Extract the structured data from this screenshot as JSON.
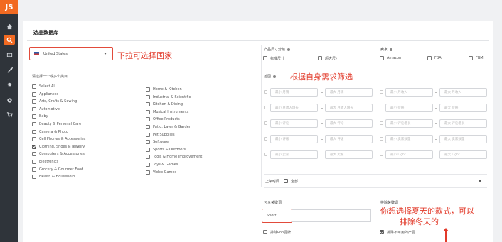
{
  "sidebar": {
    "logo": "JS",
    "icons": [
      "home-icon",
      "search-icon",
      "gallery-icon",
      "tools-icon",
      "graduation-icon",
      "settings-icon",
      "cart-icon"
    ]
  },
  "page": {
    "title": "选品数据库"
  },
  "country": {
    "selected": "United States"
  },
  "annotations": {
    "country_hint": "下拉可选择国家",
    "filter_hint": "根据自身需求筛选",
    "summer_hint_line1": "你想选择夏天的款式，可以",
    "summer_hint_line2": "排除冬天的"
  },
  "categories": {
    "label": "请选择一个或多个类目",
    "col1": [
      {
        "label": "Select All",
        "checked": false
      },
      {
        "label": "Appliances",
        "checked": false
      },
      {
        "label": "Arts, Crafts & Sewing",
        "checked": false
      },
      {
        "label": "Automotive",
        "checked": false
      },
      {
        "label": "Baby",
        "checked": false
      },
      {
        "label": "Beauty & Personal Care",
        "checked": false
      },
      {
        "label": "Camera & Photo",
        "checked": false
      },
      {
        "label": "Cell Phones & Accessories",
        "checked": false
      },
      {
        "label": "Clothing, Shoes & Jewelry",
        "checked": true
      },
      {
        "label": "Computers & Accessories",
        "checked": false
      },
      {
        "label": "Electronics",
        "checked": false
      },
      {
        "label": "Grocery & Gourmet Food",
        "checked": false
      },
      {
        "label": "Health & Household",
        "checked": false
      }
    ],
    "col2": [
      {
        "label": "Home & Kitchen",
        "checked": false
      },
      {
        "label": "Industrial & Scientific",
        "checked": false
      },
      {
        "label": "Kitchen & Dining",
        "checked": false
      },
      {
        "label": "Musical Instruments",
        "checked": false
      },
      {
        "label": "Office Products",
        "checked": false
      },
      {
        "label": "Patio, Lawn & Garden",
        "checked": false
      },
      {
        "label": "Pet Supplies",
        "checked": false
      },
      {
        "label": "Software",
        "checked": false
      },
      {
        "label": "Sports & Outdoors",
        "checked": false
      },
      {
        "label": "Tools & Home Improvement",
        "checked": false
      },
      {
        "label": "Toys & Games",
        "checked": false
      },
      {
        "label": "Video Games",
        "checked": false
      }
    ]
  },
  "size_tier": {
    "label": "产品尺寸分级",
    "options": [
      "标准尺寸",
      "超大尺寸"
    ]
  },
  "sellers": {
    "label": "卖家",
    "options": [
      "Amazon",
      "FBA",
      "FBM"
    ]
  },
  "range": {
    "label": "范围",
    "rows": [
      [
        "最小 月销",
        "最大 月销",
        "最小 月收入",
        "最大 月收入"
      ],
      [
        "最小 月收入增长",
        "最大 月收入增长",
        "最小 价格",
        "最大 价格"
      ],
      [
        "最小 评论",
        "最大 评论",
        "最小 评论增长",
        "最大 评论增长"
      ],
      [
        "最小 评级",
        "最大 评级",
        "最小 卖家数量",
        "最大 卖家数量"
      ],
      [
        "最小 卖家",
        "最大 卖家",
        "最小 Light",
        "最大 Light"
      ]
    ]
  },
  "listing_date": {
    "label": "上架时间",
    "value": "全部"
  },
  "include_keywords": {
    "label": "包含关键词",
    "value": "Short"
  },
  "exclude_keywords": {
    "label": "排除关键词"
  },
  "bottom": {
    "exclude_brand": "排除Pop品牌",
    "exclude_unavailable": "排除不可用的产品"
  }
}
